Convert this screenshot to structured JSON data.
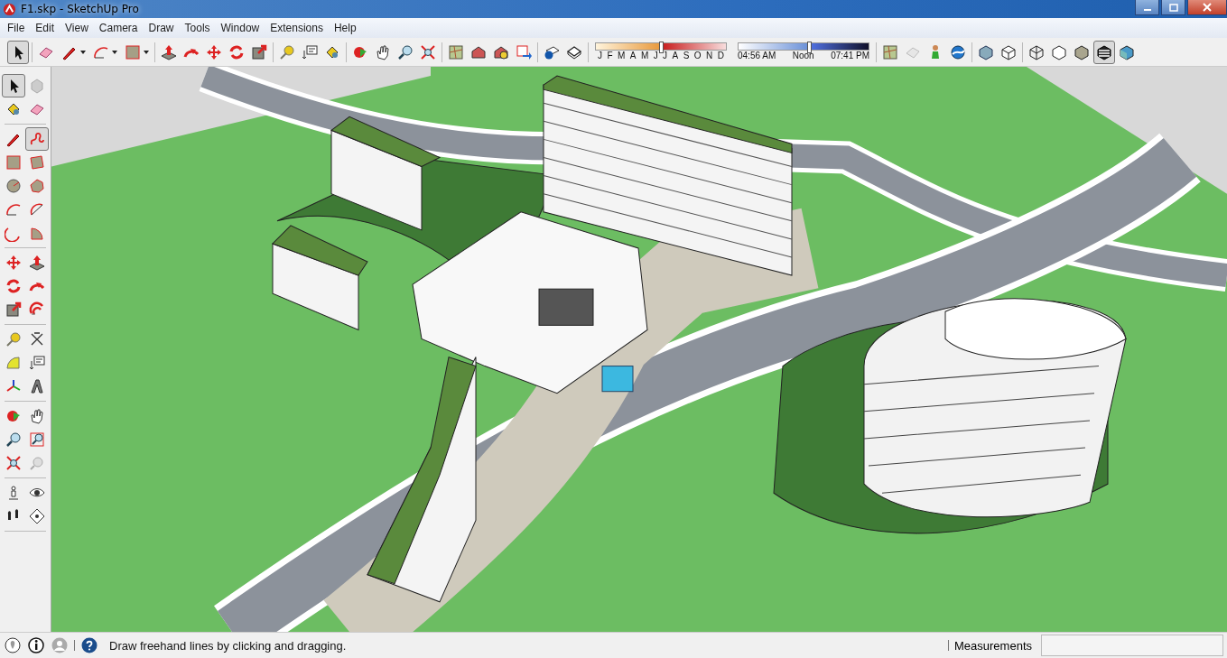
{
  "window": {
    "title": "F1.skp - SketchUp Pro"
  },
  "menu": [
    "File",
    "Edit",
    "View",
    "Camera",
    "Draw",
    "Tools",
    "Window",
    "Extensions",
    "Help"
  ],
  "toolbar": {
    "groups": [
      {
        "tools": [
          {
            "kind": "select",
            "selected": true
          }
        ]
      },
      {
        "tools": [
          {
            "kind": "eraser",
            "selected": false
          },
          {
            "kind": "pencil",
            "selected": false
          },
          {
            "kind": "arc",
            "selected": false
          },
          {
            "kind": "rectangle",
            "selected": false
          }
        ]
      },
      {
        "tools": [
          {
            "kind": "pushpull",
            "selected": false
          },
          {
            "kind": "followme",
            "selected": false
          },
          {
            "kind": "move",
            "selected": false
          },
          {
            "kind": "rotate",
            "selected": false
          },
          {
            "kind": "scale",
            "selected": false
          }
        ]
      },
      {
        "tools": [
          {
            "kind": "tape",
            "selected": false
          },
          {
            "kind": "text",
            "selected": false
          },
          {
            "kind": "paint",
            "selected": false
          }
        ]
      },
      {
        "tools": [
          {
            "kind": "orbit",
            "selected": false
          },
          {
            "kind": "pan",
            "selected": false
          },
          {
            "kind": "zoom",
            "selected": false
          },
          {
            "kind": "extents",
            "selected": false
          }
        ]
      },
      {
        "tools": [
          {
            "kind": "map",
            "selected": false
          },
          {
            "kind": "model",
            "selected": false
          },
          {
            "kind": "share",
            "selected": false
          },
          {
            "kind": "send",
            "selected": false
          }
        ]
      },
      {
        "tools": [
          {
            "kind": "info",
            "selected": false
          },
          {
            "kind": "page",
            "selected": false
          }
        ]
      }
    ],
    "shadows": {
      "date_slider": {
        "level": 0.5,
        "months": [
          "J",
          "F",
          "M",
          "A",
          "M",
          "J",
          "J",
          "A",
          "S",
          "O",
          "N",
          "D"
        ]
      },
      "time_slider": {
        "level": 0.54,
        "start": "04:56 AM",
        "middle": "Noon",
        "end": "07:41 PM"
      }
    },
    "groups2": [
      {
        "tools": [
          {
            "kind": "map",
            "selected": false
          },
          {
            "kind": "sandbox",
            "selected": false
          },
          {
            "kind": "person",
            "selected": false
          },
          {
            "kind": "globe",
            "selected": false
          }
        ]
      },
      {
        "tools": [
          {
            "kind": "iso",
            "selected": false
          },
          {
            "kind": "cube",
            "selected": false
          }
        ]
      },
      {
        "tools": [
          {
            "kind": "xray",
            "selected": false
          },
          {
            "kind": "hidden",
            "selected": false
          },
          {
            "kind": "shaded",
            "selected": false
          },
          {
            "kind": "mono",
            "selected": true
          },
          {
            "kind": "textured",
            "selected": false
          }
        ]
      }
    ]
  },
  "left_toolbar": {
    "groups": [
      {
        "tools": [
          {
            "kind": "select",
            "selected": true
          },
          {
            "kind": "component",
            "selected": false
          },
          {
            "kind": "paint",
            "selected": false
          },
          {
            "kind": "eraser",
            "selected": false
          }
        ]
      },
      {
        "tools": [
          {
            "kind": "pencil",
            "selected": false
          },
          {
            "kind": "freehand",
            "selected": true
          },
          {
            "kind": "rectangle",
            "selected": false
          },
          {
            "kind": "rotrect",
            "selected": false
          },
          {
            "kind": "circle",
            "selected": false
          },
          {
            "kind": "polygon",
            "selected": false
          },
          {
            "kind": "arc",
            "selected": false
          },
          {
            "kind": "arc2",
            "selected": false
          },
          {
            "kind": "arc3",
            "selected": false
          },
          {
            "kind": "pie",
            "selected": false
          }
        ]
      },
      {
        "tools": [
          {
            "kind": "move",
            "selected": false
          },
          {
            "kind": "pushpull",
            "selected": false
          },
          {
            "kind": "rotate",
            "selected": false
          },
          {
            "kind": "followme",
            "selected": false
          },
          {
            "kind": "scale",
            "selected": false
          },
          {
            "kind": "offset",
            "selected": false
          }
        ]
      },
      {
        "tools": [
          {
            "kind": "tape",
            "selected": false
          },
          {
            "kind": "dimension",
            "selected": false
          },
          {
            "kind": "protractor",
            "selected": false
          },
          {
            "kind": "text",
            "selected": false
          },
          {
            "kind": "axes",
            "selected": false
          },
          {
            "kind": "text3d",
            "selected": false
          }
        ]
      },
      {
        "tools": [
          {
            "kind": "orbit",
            "selected": false
          },
          {
            "kind": "pan",
            "selected": false
          },
          {
            "kind": "zoom",
            "selected": false
          },
          {
            "kind": "zoomwindow",
            "selected": false
          },
          {
            "kind": "extents",
            "selected": false
          },
          {
            "kind": "previous",
            "selected": false
          }
        ]
      },
      {
        "tools": [
          {
            "kind": "camera",
            "selected": false
          },
          {
            "kind": "look",
            "selected": false
          },
          {
            "kind": "walk",
            "selected": false
          },
          {
            "kind": "section",
            "selected": false
          }
        ]
      }
    ]
  },
  "status_bar": {
    "hint": "Draw freehand lines by clicking and dragging.",
    "measurements_label": "Measurements"
  }
}
